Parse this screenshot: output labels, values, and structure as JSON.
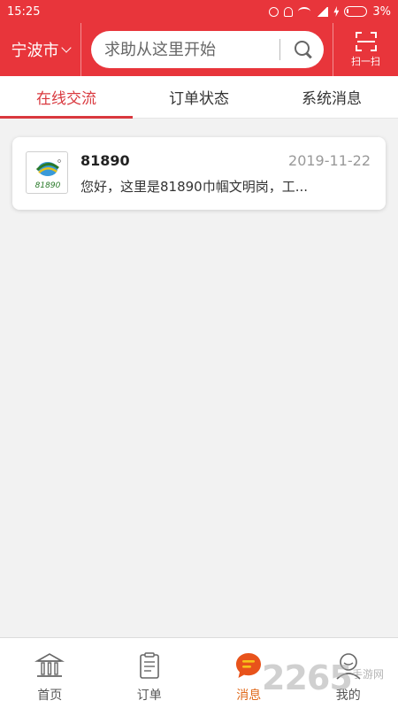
{
  "status_bar": {
    "time": "15:25",
    "battery": "3%"
  },
  "header": {
    "city": "宁波市",
    "search_placeholder": "求助从这里开始",
    "scan_label": "扫一扫"
  },
  "tabs": [
    {
      "label": "在线交流",
      "active": true
    },
    {
      "label": "订单状态",
      "active": false
    },
    {
      "label": "系统消息",
      "active": false
    }
  ],
  "messages": [
    {
      "sender": "81890",
      "date": "2019-11-22",
      "preview": "您好，这里是81890巾帼文明岗，工...",
      "logo_text": "81890"
    }
  ],
  "bottom_nav": [
    {
      "label": "首页",
      "icon": "home-icon",
      "active": false
    },
    {
      "label": "订单",
      "icon": "order-clipboard-icon",
      "active": false
    },
    {
      "label": "消息",
      "icon": "message-bubble-icon",
      "active": true
    },
    {
      "label": "我的",
      "icon": "profile-icon",
      "active": false
    }
  ],
  "watermark": {
    "number": "2265",
    "site": "手游网"
  },
  "colors": {
    "brand_red": "#e8353b",
    "active_tab": "#d9383e",
    "active_nav": "#e06a1b"
  }
}
